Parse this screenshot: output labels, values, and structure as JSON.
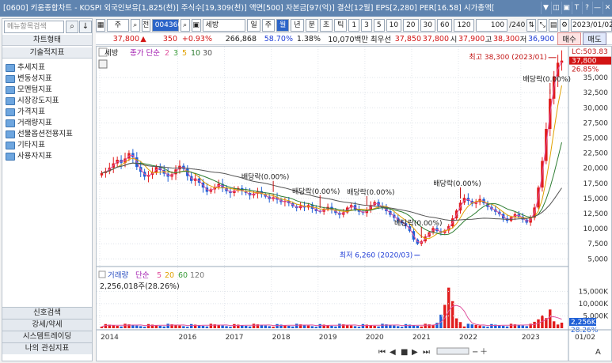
{
  "title": {
    "text": "[0600] 키움종합차트 - KOSPI 외국인보유[1,825(천)] 주식수[19,309(천)] 액면[500] 자본금[97(억)] 결산[12월] EPS[2,280] PER[16.58] 시가총액[",
    "icons": [
      "▼",
      "◫",
      "▣",
      "T",
      "?",
      "—",
      "✕"
    ]
  },
  "sidebar": {
    "search_placeholder": "메뉴항목검색",
    "chart_type": "차트형태",
    "tech": "기술적지표",
    "items": [
      "추세지표",
      "변동성지표",
      "모멘텀지표",
      "시장강도지표",
      "가격지표",
      "거래량지표",
      "선물옵션전용지표",
      "기타지표",
      "사용자지표"
    ],
    "bottom": [
      "신호검색",
      "강세/약세",
      "시스템트레이딩",
      "나의 관심지표"
    ]
  },
  "toolbar": {
    "type": "주",
    "code": "004360",
    "name": "세방",
    "periods": [
      "일",
      "주",
      "월",
      "년",
      "분",
      "초",
      "틱"
    ],
    "selected": "월",
    "nums": [
      "1",
      "3",
      "5",
      "10",
      "20",
      "30",
      "60",
      "120"
    ],
    "count": "100",
    "total": "/240",
    "date": "2023/01/02"
  },
  "pricebar": {
    "price": "37,800",
    "change": "350",
    "pct": "+0.93%",
    "volume": "266,868",
    "vol_ratio": "58.70%",
    "turnover": "1.38%",
    "amount": "10,070백만",
    "cmp_label": "최우선",
    "bid1": "37,850",
    "bid2": "37,800",
    "open_l": "시",
    "open": "37,900",
    "high_l": "고",
    "high": "38,300",
    "low_l": "저",
    "low": "36,900",
    "buy": "매수",
    "sell": "매도"
  },
  "chart_data": {
    "type": "candlestick",
    "legend": {
      "name": "세방",
      "ma_label": "종가 단순",
      "ma": [
        "2",
        "3",
        "5",
        "10",
        "30"
      ],
      "ma_colors": [
        "#e0529e",
        "#3b9d3b",
        "#e0a000",
        "#2e7d32",
        "#444444"
      ]
    },
    "yaxis": {
      "ticks": [
        5000,
        7500,
        10000,
        12500,
        15000,
        17500,
        20000,
        22500,
        25000,
        27500,
        30000,
        32500,
        35000
      ],
      "labels": [
        "5,000",
        "7,500",
        "10,000",
        "12,500",
        "15,000",
        "17,500",
        "20,000",
        "22,500",
        "25,000",
        "27,500",
        "30,000",
        "32,500",
        "35,000"
      ],
      "extra": [
        "LC:503.83",
        "37,800",
        "26.85%"
      ]
    },
    "x_years": [
      "2014",
      "2016",
      "2017",
      "2018",
      "2019",
      "2020",
      "2021",
      "2022",
      "2023"
    ],
    "x_end": "01/02",
    "annotations": {
      "high": "최고 38,300 (2023/01)",
      "low": "최저 6,260 (2020/03)",
      "dividends": [
        "배당락(0.00%)",
        "배당락(0.00%)",
        "배당락(0.00%)",
        "배당락(0.00%)",
        "배당락(0.00%)",
        "배당락(0.00%)"
      ]
    },
    "closes": [
      19200,
      19500,
      20100,
      20800,
      21400,
      20900,
      21600,
      22500,
      21800,
      20200,
      19400,
      18600,
      18900,
      19300,
      20200,
      19700,
      19100,
      18600,
      19000,
      19800,
      20400,
      19900,
      18700,
      17900,
      18300,
      17600,
      16800,
      16100,
      16500,
      16900,
      17400,
      16800,
      16200,
      15900,
      16300,
      16700,
      16200,
      15900,
      15500,
      15800,
      16200,
      15700,
      15300,
      14900,
      15200,
      14800,
      14400,
      14600,
      14200,
      13700,
      13400,
      13800,
      13500,
      13900,
      13300,
      12900,
      12800,
      13200,
      13600,
      13100,
      12600,
      12300,
      12700,
      13500,
      13900,
      13200,
      12800,
      12600,
      13100,
      13900,
      14400,
      13800,
      13400,
      12900,
      12300,
      11800,
      11300,
      10900,
      10400,
      9600,
      8200,
      7500,
      7900,
      8700,
      9400,
      10100,
      9600,
      9300,
      9700,
      10400,
      11700,
      13000,
      14300,
      15100,
      14600,
      14100,
      14400,
      14900,
      14200,
      13600,
      13200,
      12800,
      12400,
      11700,
      11300,
      11900,
      12400,
      12000,
      11500,
      11000,
      11800,
      13500,
      16800,
      21200,
      26500,
      31500,
      35200,
      37450,
      37800
    ],
    "volume": {
      "label": "거래량",
      "ma_label": "단순",
      "ma": [
        "5",
        "20",
        "60",
        "120"
      ],
      "current": "2,256,018주(28.26%)",
      "ticks": [
        "5,000K",
        "10,000K",
        "15,000K"
      ],
      "last": "2,256K",
      "pct": "28.26%"
    }
  }
}
